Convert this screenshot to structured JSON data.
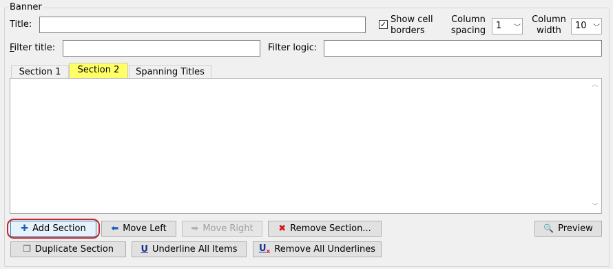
{
  "group": {
    "label": "Banner"
  },
  "title": {
    "label": "Title:",
    "value": ""
  },
  "show_cell_borders": {
    "label_line1": "Show cell",
    "label_line2": "borders",
    "checked": true,
    "mark": "✓"
  },
  "column_spacing": {
    "label_line1": "Column",
    "label_line2": "spacing",
    "value": "1"
  },
  "column_width": {
    "label_line1": "Column",
    "label_line2": "width",
    "value": "10"
  },
  "filter_title": {
    "label_prefix": "F",
    "label_rest": "ilter title:",
    "value": ""
  },
  "filter_logic": {
    "label": "Filter logic:",
    "value": ""
  },
  "tabs": [
    {
      "label": "Section 1",
      "active": false
    },
    {
      "label": "Section 2",
      "active": true
    },
    {
      "label": "Spanning Titles",
      "active": false
    }
  ],
  "buttons": {
    "add_section": {
      "label": "Add Section",
      "icon": "plus-icon",
      "glyph": "✚"
    },
    "move_left": {
      "label": "Move Left",
      "icon": "arrow-left-icon",
      "glyph": "⬅"
    },
    "move_right": {
      "label": "Move Right",
      "icon": "arrow-right-icon",
      "glyph": "➡",
      "disabled": true
    },
    "remove_section": {
      "label": "Remove Section...",
      "icon": "red-x-icon",
      "glyph": "✖"
    },
    "preview": {
      "label": "Preview",
      "icon": "magnifier-icon",
      "glyph": "🔍"
    },
    "duplicate_section": {
      "label": "Duplicate Section",
      "icon": "duplicate-icon",
      "glyph": "❐"
    },
    "underline_all": {
      "label": "Underline All Items",
      "icon": "underline-icon",
      "glyph": "U"
    },
    "remove_underlines": {
      "label": "Remove All Underlines",
      "icon": "remove-underline-icon",
      "glyph": "U",
      "sub": "x"
    }
  },
  "colors": {
    "active_tab": "#ffff66",
    "highlight_ring": "#c0282d",
    "remove_icon": "#d01c1c",
    "nav_icon": "#1e5fb4"
  }
}
